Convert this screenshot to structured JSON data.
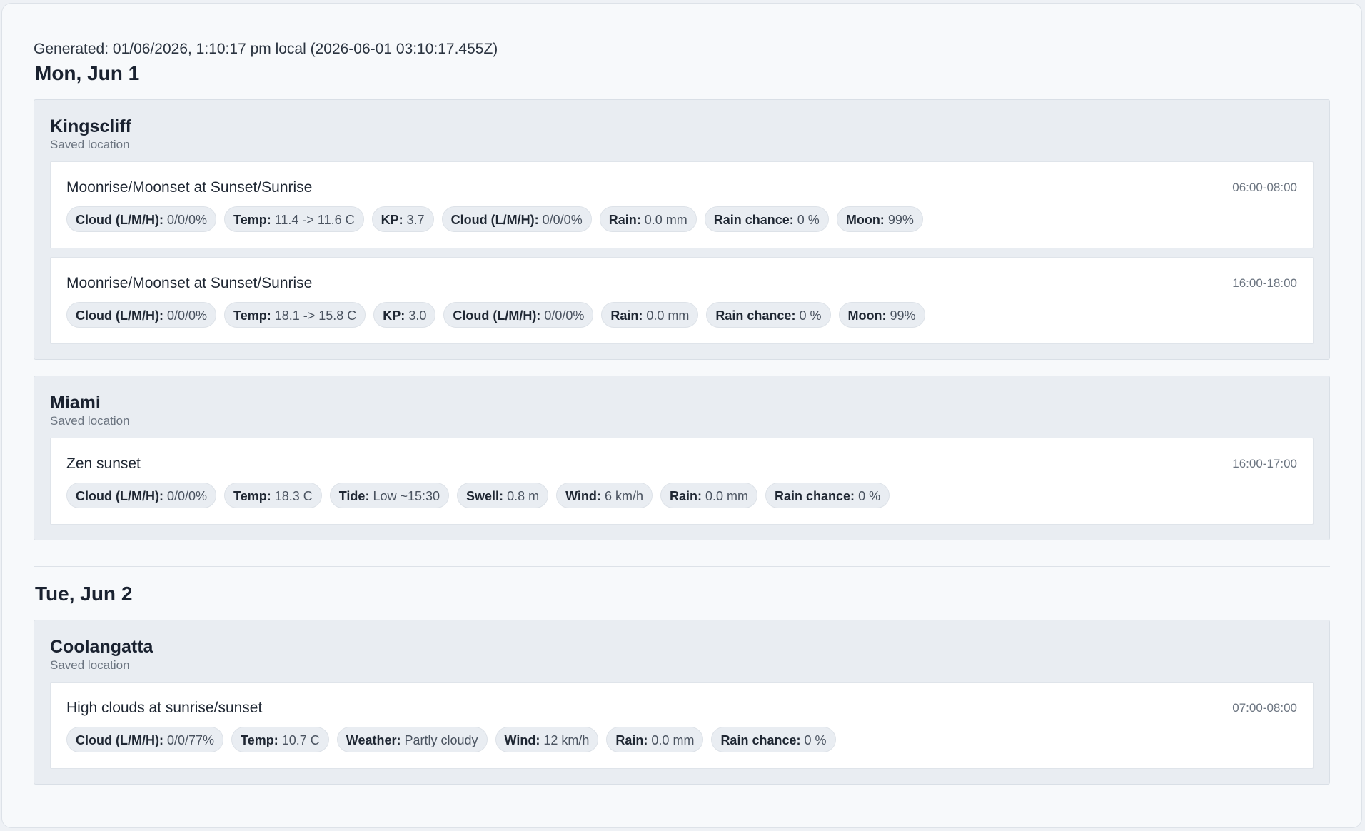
{
  "generated_text": "Generated: 01/06/2026, 1:10:17 pm local (2026-06-01 03:10:17.455Z)",
  "days": [
    {
      "heading": "Mon, Jun 1",
      "locations": [
        {
          "name": "Kingscliff",
          "subtitle": "Saved location",
          "events": [
            {
              "title": "Moonrise/Moonset at Sunset/Sunrise",
              "time": "06:00-08:00",
              "chips": [
                {
                  "label": "Cloud (L/M/H):",
                  "value": "0/0/0%"
                },
                {
                  "label": "Temp:",
                  "value": "11.4 -> 11.6 C"
                },
                {
                  "label": "KP:",
                  "value": "3.7"
                },
                {
                  "label": "Cloud (L/M/H):",
                  "value": "0/0/0%"
                },
                {
                  "label": "Rain:",
                  "value": "0.0 mm"
                },
                {
                  "label": "Rain chance:",
                  "value": "0 %"
                },
                {
                  "label": "Moon:",
                  "value": "99%"
                }
              ]
            },
            {
              "title": "Moonrise/Moonset at Sunset/Sunrise",
              "time": "16:00-18:00",
              "chips": [
                {
                  "label": "Cloud (L/M/H):",
                  "value": "0/0/0%"
                },
                {
                  "label": "Temp:",
                  "value": "18.1 -> 15.8 C"
                },
                {
                  "label": "KP:",
                  "value": "3.0"
                },
                {
                  "label": "Cloud (L/M/H):",
                  "value": "0/0/0%"
                },
                {
                  "label": "Rain:",
                  "value": "0.0 mm"
                },
                {
                  "label": "Rain chance:",
                  "value": "0 %"
                },
                {
                  "label": "Moon:",
                  "value": "99%"
                }
              ]
            }
          ]
        },
        {
          "name": "Miami",
          "subtitle": "Saved location",
          "events": [
            {
              "title": "Zen sunset",
              "time": "16:00-17:00",
              "chips": [
                {
                  "label": "Cloud (L/M/H):",
                  "value": "0/0/0%"
                },
                {
                  "label": "Temp:",
                  "value": "18.3 C"
                },
                {
                  "label": "Tide:",
                  "value": "Low ~15:30"
                },
                {
                  "label": "Swell:",
                  "value": "0.8 m"
                },
                {
                  "label": "Wind:",
                  "value": "6 km/h"
                },
                {
                  "label": "Rain:",
                  "value": "0.0 mm"
                },
                {
                  "label": "Rain chance:",
                  "value": "0 %"
                }
              ]
            }
          ]
        }
      ]
    },
    {
      "heading": "Tue, Jun 2",
      "locations": [
        {
          "name": "Coolangatta",
          "subtitle": "Saved location",
          "events": [
            {
              "title": "High clouds at sunrise/sunset",
              "time": "07:00-08:00",
              "chips": [
                {
                  "label": "Cloud (L/M/H):",
                  "value": "0/0/77%"
                },
                {
                  "label": "Temp:",
                  "value": "10.7 C"
                },
                {
                  "label": "Weather:",
                  "value": "Partly cloudy"
                },
                {
                  "label": "Wind:",
                  "value": "12 km/h"
                },
                {
                  "label": "Rain:",
                  "value": "0.0 mm"
                },
                {
                  "label": "Rain chance:",
                  "value": "0 %"
                }
              ]
            }
          ]
        }
      ]
    }
  ]
}
